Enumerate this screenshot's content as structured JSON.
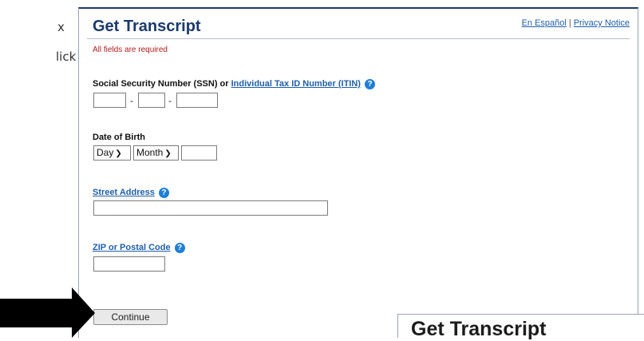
{
  "side_text": {
    "line1": "x",
    "line2": "lick"
  },
  "form": {
    "title": "Get Transcript",
    "links": {
      "spanish": "En Español",
      "separator": "|",
      "privacy": "Privacy Notice"
    },
    "required_note": "All fields are required",
    "ssn": {
      "label_prefix": "Social Security Number (SSN) or ",
      "label_link": "Individual Tax ID Number (ITIN)",
      "part1": "",
      "part2": "",
      "part3": "",
      "separator": "-"
    },
    "dob": {
      "label": "Date of Birth",
      "day_selected": "Day",
      "month_selected": "Month",
      "year": ""
    },
    "street": {
      "label": "Street Address",
      "value": ""
    },
    "zip": {
      "label": "ZIP or Postal Code",
      "value": ""
    },
    "continue_label": "Continue",
    "help_glyph": "?"
  },
  "overlay": {
    "title": "Get Transcript"
  }
}
